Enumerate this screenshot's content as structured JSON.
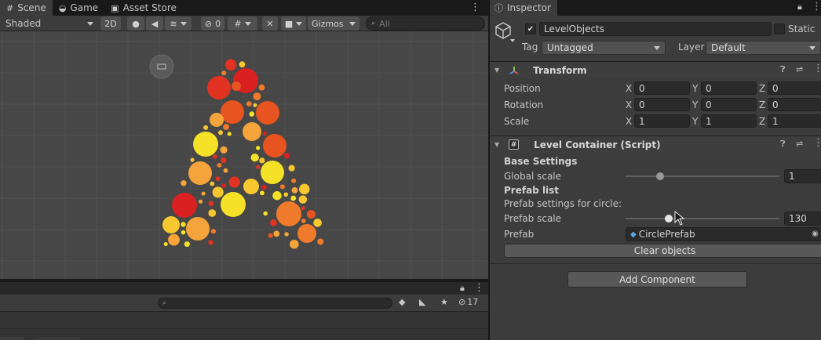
{
  "scene_tabs": [
    {
      "label": "Scene",
      "icon": "grid-icon"
    },
    {
      "label": "Game",
      "icon": "gamepad-icon"
    },
    {
      "label": "Asset Store",
      "icon": "bag-icon"
    }
  ],
  "scene_toolbar": {
    "shading": "Shaded",
    "mode_2d": "2D",
    "hidden_count": "0",
    "gizmos": "Gizmos",
    "search_placeholder": "All"
  },
  "bottom_panel": {
    "hidden_count": "17"
  },
  "inspector": {
    "tab": "Inspector",
    "object_name": "LevelObjects",
    "static_label": "Static",
    "tag_label": "Tag",
    "tag_value": "Untagged",
    "layer_label": "Layer",
    "layer_value": "Default",
    "transform": {
      "title": "Transform",
      "rows": [
        {
          "label": "Position",
          "x": "0",
          "y": "0",
          "z": "0"
        },
        {
          "label": "Rotation",
          "x": "0",
          "y": "0",
          "z": "0"
        },
        {
          "label": "Scale",
          "x": "1",
          "y": "1",
          "z": "1"
        }
      ],
      "axis": {
        "x": "X",
        "y": "Y",
        "z": "Z"
      }
    },
    "script": {
      "title": "Level Container (Script)",
      "base_settings": "Base Settings",
      "global_scale_label": "Global scale",
      "global_scale_value": "1",
      "global_scale_fraction": 0.21,
      "prefab_list": "Prefab list",
      "prefab_settings": "Prefab settings for circle:",
      "prefab_scale_label": "Prefab scale",
      "prefab_scale_value": "130",
      "prefab_scale_fraction": 0.27,
      "prefab_label": "Prefab",
      "prefab_value": "CirclePrefab",
      "clear_button": "Clear objects"
    },
    "add_component": "Add Component"
  }
}
